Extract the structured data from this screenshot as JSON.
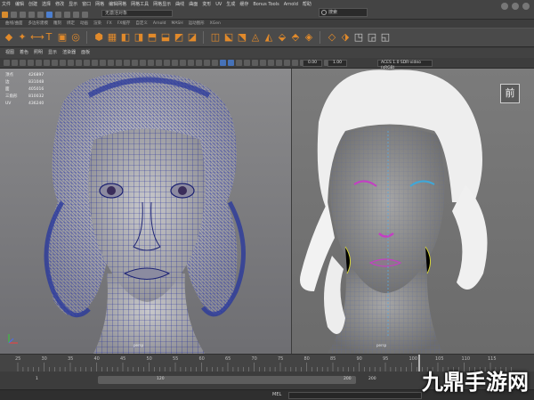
{
  "menubar": {
    "items": [
      "文件",
      "编辑",
      "创建",
      "选择",
      "修改",
      "显示",
      "窗口",
      "网格",
      "编辑网格",
      "网格工具",
      "网格显示",
      "曲线",
      "曲面",
      "变形",
      "UV",
      "生成",
      "缓存",
      "Bonus Tools",
      "Arnold",
      "帮助"
    ],
    "workspace_label": "无激活对象",
    "search_placeholder": "搜索"
  },
  "shelf_tabs": [
    "曲线/曲面",
    "多边形建模",
    "雕刻",
    "绑定",
    "动画",
    "渲染",
    "FX",
    "FX缓存",
    "自定义",
    "Arnold",
    "MASH",
    "运动图形",
    "XGen"
  ],
  "shelf_icons": [
    "sphere",
    "cube",
    "cylinder",
    "cone",
    "plane",
    "torus",
    "text",
    "svg",
    "combine",
    "separate",
    "extrude",
    "bridge",
    "bevel",
    "fill",
    "append",
    "multi-cut",
    "target-weld",
    "connect",
    "quad-draw",
    "edge-loop",
    "mirror",
    "smooth",
    "reduce",
    "retopo",
    "uv-editor",
    "uv-unfold",
    "uv-layout"
  ],
  "panel_menus": [
    "视图",
    "着色",
    "照明",
    "显示",
    "渲染器",
    "面板"
  ],
  "toolbar": {
    "field1": "0.00",
    "field2": "1.00",
    "color_space": "ACES 1.0 SDR-video (sRGB)"
  },
  "hud": [
    {
      "label": "顶点",
      "value": "426897"
    },
    {
      "label": "边",
      "value": "831048"
    },
    {
      "label": "面",
      "value": "405016"
    },
    {
      "label": "三角形",
      "value": "810032"
    },
    {
      "label": "UV",
      "value": "436240"
    }
  ],
  "viewport": {
    "left_label": "persp",
    "right_label": "persp",
    "view_badge": "前"
  },
  "timeline": {
    "ticks": [
      "25",
      "30",
      "35",
      "40",
      "45",
      "50",
      "55",
      "60",
      "65",
      "70",
      "75",
      "80",
      "85",
      "90",
      "95",
      "100",
      "105",
      "110",
      "115"
    ]
  },
  "range": {
    "start": "1",
    "range_start": "120",
    "range_end": "200",
    "end": "200"
  },
  "cmdline": {
    "tab": "MEL"
  },
  "watermark": "九鼎手游网",
  "colors": {
    "accent": "#e18a2b",
    "wire": "#2a2f9a",
    "background": "#3a3a3a"
  }
}
